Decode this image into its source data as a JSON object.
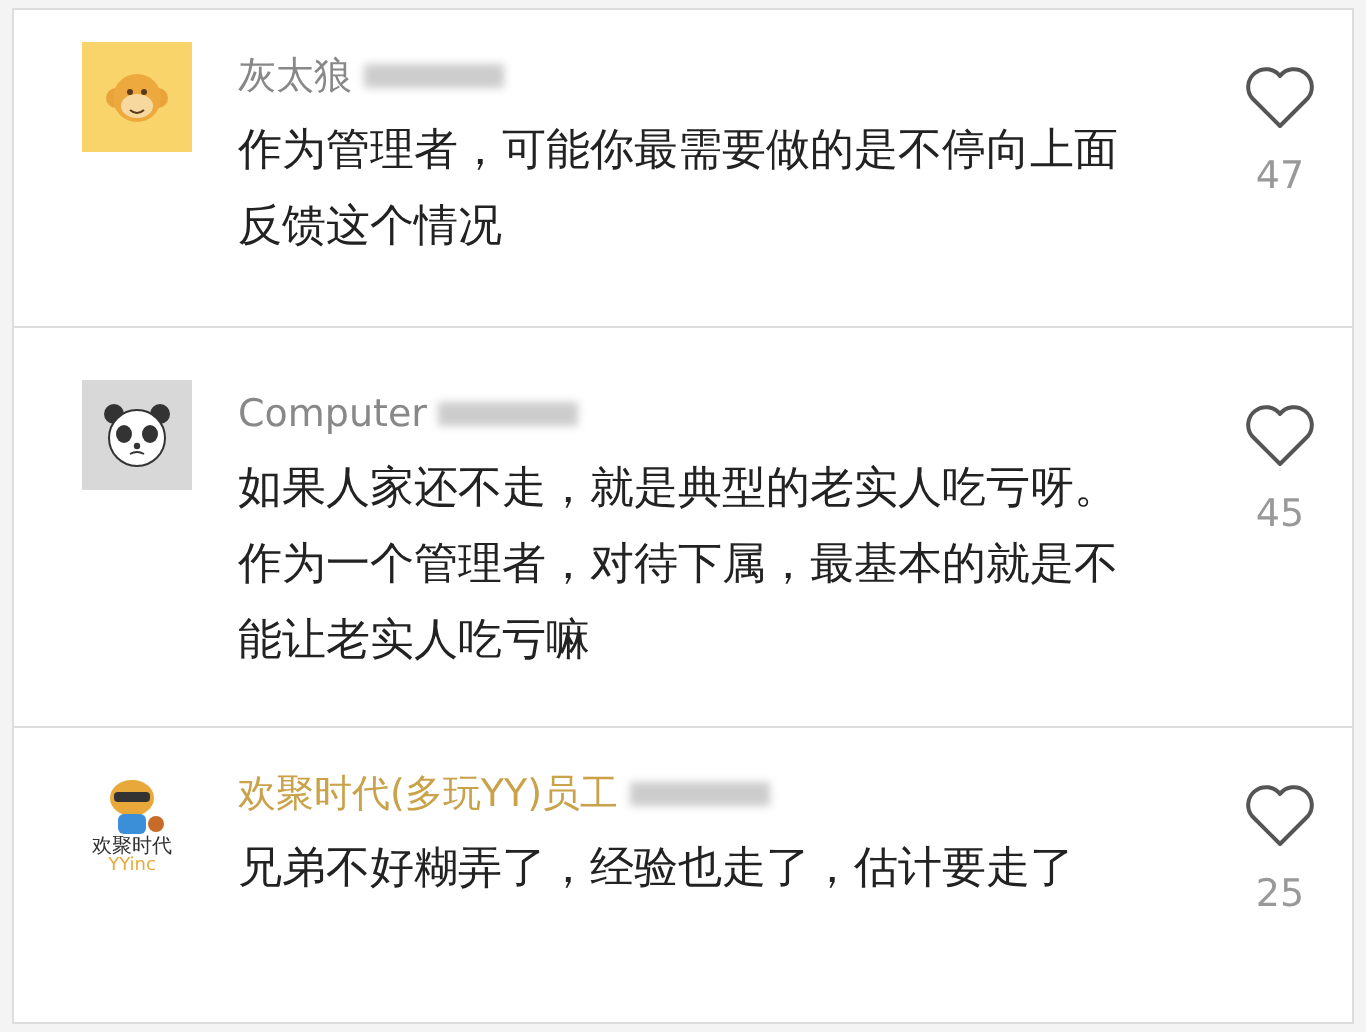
{
  "comments": [
    {
      "avatar": {
        "kind": "monkey"
      },
      "author": "灰太狼",
      "verified": false,
      "text": "作为管理者，可能你最需要做的是不停向上面反馈这个情况",
      "likes": "47",
      "liked": false
    },
    {
      "avatar": {
        "kind": "panda"
      },
      "author": "Computer",
      "verified": false,
      "text": "如果人家还不走，就是典型的老实人吃亏呀。作为一个管理者，对待下属，最基本的就是不能让老实人吃亏嘛",
      "likes": "45",
      "liked": false
    },
    {
      "avatar": {
        "kind": "logo",
        "logo_text": "欢聚时代",
        "logo_subtext": "YYinc"
      },
      "author": "欢聚时代(多玩YY)员工",
      "verified": true,
      "text": "兄弟不好糊弄了，经验也走了，估计要走了",
      "likes": "25",
      "liked": false
    }
  ]
}
